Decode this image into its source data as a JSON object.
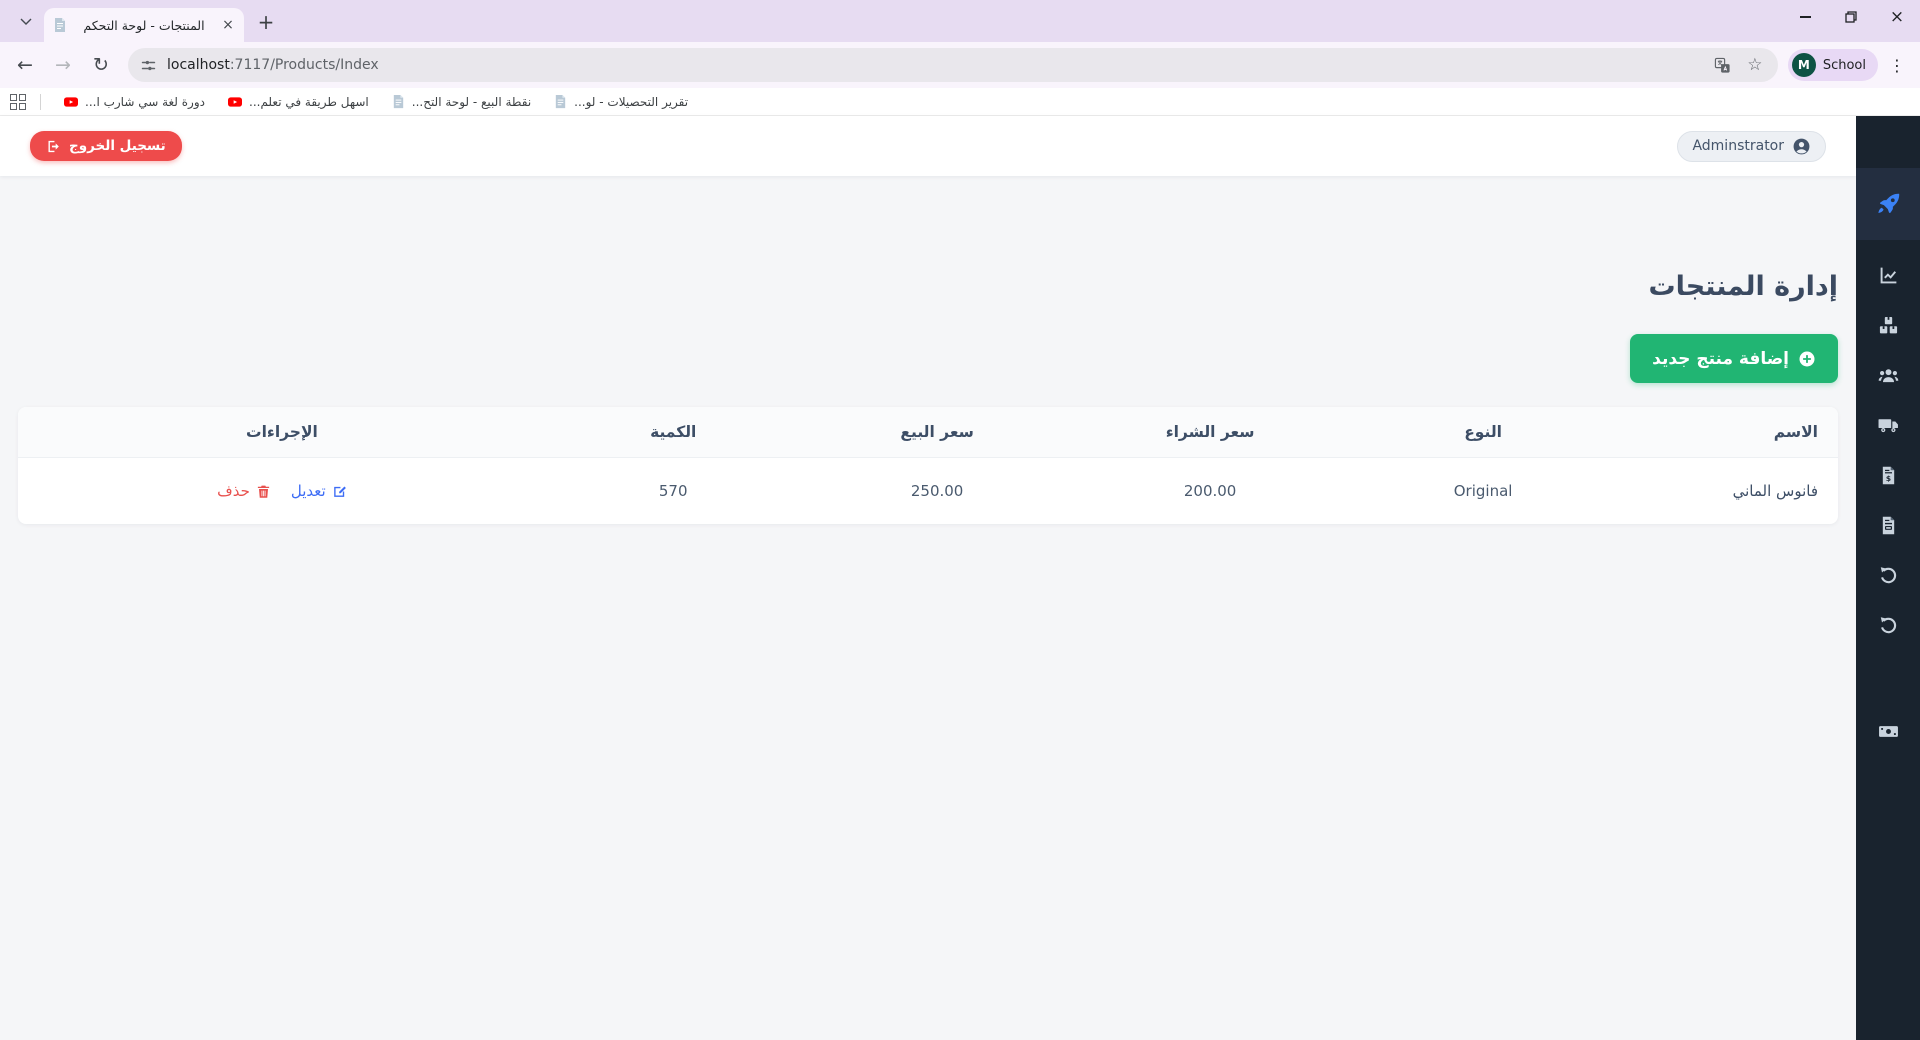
{
  "browser": {
    "tab": {
      "title": "المنتجات - لوحة التحكم",
      "close_glyph": "×",
      "new_tab_glyph": "+"
    },
    "address": {
      "host": "localhost",
      "path": ":7117/Products/Index"
    },
    "profile": {
      "initial": "M",
      "name": "School"
    },
    "bookmarks": [
      {
        "label": "دورة لغة سي شارب ا...",
        "icon": "youtube-icon"
      },
      {
        "label": "اسهل طريقة في تعلم...",
        "icon": "youtube-icon"
      },
      {
        "label": "نقطة البيع - لوحة التح...",
        "icon": "page-icon"
      },
      {
        "label": "تقرير التحصيلات - لو...",
        "icon": "page-icon"
      }
    ],
    "toolbar_glyphs": {
      "back": "←",
      "forward": "→",
      "reload": "↻",
      "star": "☆",
      "more": "⋮"
    }
  },
  "app": {
    "navbar": {
      "logout": "تسجيل الخروج",
      "user": "Adminstrator"
    },
    "page_title": "إدارة المنتجات",
    "add_button": "إضافة منتج جديد",
    "table": {
      "headers": [
        "الاسم",
        "النوع",
        "سعر الشراء",
        "سعر البيع",
        "الكمية",
        "الإجراءات"
      ],
      "row": {
        "name": "فانوس الماني",
        "type": "Original",
        "purchase_price": "200.00",
        "sale_price": "250.00",
        "quantity": "570",
        "edit": "تعديل",
        "delete": "حذف"
      }
    },
    "sidebar": {
      "items": [
        "rocket-icon",
        "chart-line-icon",
        "boxes-icon",
        "users-icon",
        "truck-icon",
        "file-invoice-dollar-icon",
        "file-lines-icon",
        "undo-icon",
        "undo-icon",
        "money-bill-icon"
      ]
    },
    "colors": {
      "accent_green": "#21b573",
      "danger_red": "#ee4b4b",
      "link_blue": "#3d6cf5",
      "delete_red": "#e8504d",
      "sidebar_bg": "#19232e",
      "rocket_blue": "#3b82f6",
      "title_text": "#3b4a61"
    }
  }
}
